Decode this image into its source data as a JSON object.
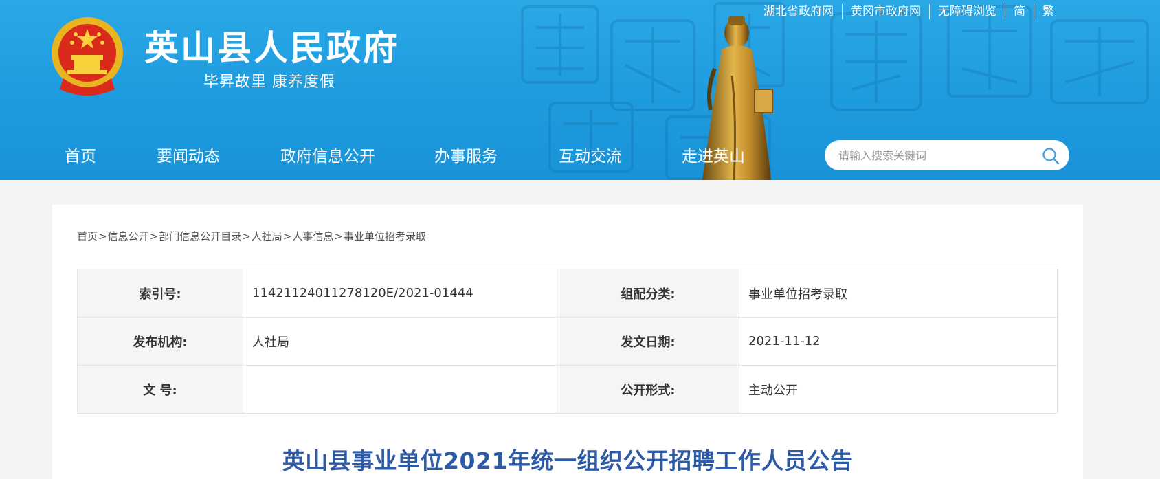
{
  "header": {
    "site_title": "英山县人民政府",
    "slogan": "毕昇故里 康养度假",
    "top_links": [
      "湖北省政府网",
      "黄冈市政府网",
      "无障碍浏览",
      "简",
      "繁"
    ],
    "brand_color": "#1e9bde"
  },
  "nav": {
    "items": [
      "首页",
      "要闻动态",
      "政府信息公开",
      "办事服务",
      "互动交流",
      "走进英山"
    ]
  },
  "search": {
    "placeholder": "请输入搜索关键词",
    "icon": "search-icon"
  },
  "breadcrumb": {
    "items": [
      "首页",
      "信息公开",
      "部门信息公开目录",
      "人社局",
      "人事信息",
      "事业单位招考录取"
    ],
    "separator": ">"
  },
  "info": {
    "index_label": "索引号:",
    "index_value": "11421124011278120E/2021-01444",
    "category_label": "组配分类:",
    "category_value": "事业单位招考录取",
    "publisher_label": "发布机构:",
    "publisher_value": "人社局",
    "date_label": "发文日期:",
    "date_value": "2021-11-12",
    "docno_label": "文 号:",
    "docno_value": "",
    "disclosure_label": "公开形式:",
    "disclosure_value": "主动公开"
  },
  "article": {
    "title": "英山县事业单位2021年统一组织公开招聘工作人员公告",
    "title_color": "#2c5aa7"
  }
}
